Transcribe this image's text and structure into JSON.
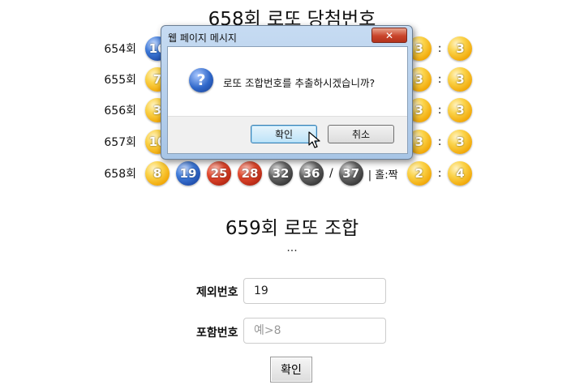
{
  "title": "658회 로또 당첨번호",
  "rows": [
    {
      "label": "654회",
      "numbers": [
        "16",
        "",
        "",
        "",
        "",
        ""
      ],
      "bonus": "",
      "oddeven": "",
      "odd": "3",
      "even": "3",
      "hidden": true
    },
    {
      "label": "655회",
      "numbers": [
        "7",
        "",
        "",
        "",
        "",
        ""
      ],
      "bonus": "",
      "oddeven": "",
      "odd": "3",
      "even": "3",
      "hidden": true
    },
    {
      "label": "656회",
      "numbers": [
        "3",
        "",
        "",
        "",
        "",
        ""
      ],
      "bonus": "",
      "oddeven": "",
      "odd": "3",
      "even": "3",
      "hidden": true
    },
    {
      "label": "657회",
      "numbers": [
        "10",
        "",
        "",
        "",
        "",
        ""
      ],
      "bonus": "",
      "oddeven": "",
      "odd": "3",
      "even": "3",
      "hidden": true
    },
    {
      "label": "658회",
      "numbers": [
        "8",
        "19",
        "25",
        "28",
        "32",
        "36"
      ],
      "bonus": "37",
      "oddeven": "| 홀:짝",
      "odd": "2",
      "even": "4",
      "hidden": false
    }
  ],
  "ball_colors": {
    "yellow": "#f0a300",
    "blue": "#2f67c9",
    "red": "#c5301a",
    "gray": "#3a3a3a"
  },
  "subtitle": "659회 로또 조합",
  "dots": "...",
  "form": {
    "exclude_label": "제외번호",
    "exclude_value": "19",
    "include_label": "포함번호",
    "include_placeholder": "예>8",
    "submit_label": "확인"
  },
  "dialog": {
    "title": "웹 페이지 메시지",
    "close_glyph": "✕",
    "icon": "question-icon",
    "message": "로또 조합번호를 추출하시겠습니까?",
    "ok_label": "확인",
    "cancel_label": "취소"
  }
}
